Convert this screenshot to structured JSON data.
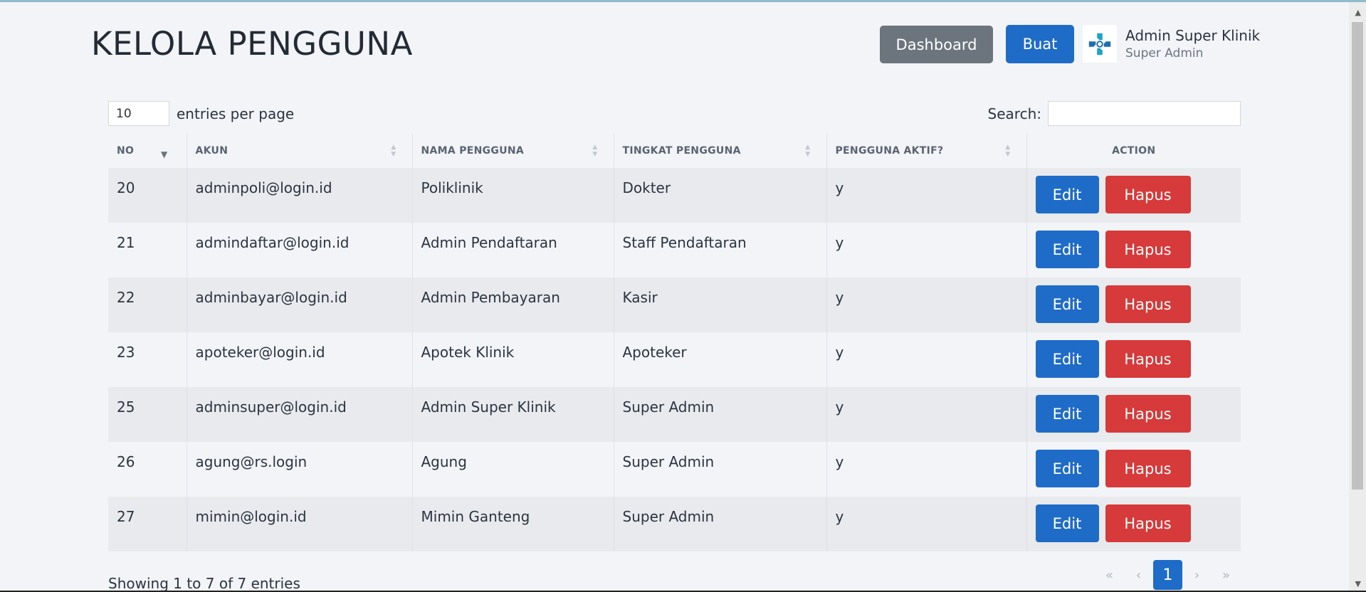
{
  "header": {
    "title": "KELOLA PENGGUNA",
    "dashboard_label": "Dashboard",
    "buat_label": "Buat",
    "user_name": "Admin Super Klinik",
    "user_role": "Super Admin",
    "logo_icon": "clinic-cross-logo-icon"
  },
  "controls": {
    "entries_value": "10",
    "entries_label": "entries per page",
    "search_label": "Search:",
    "search_value": ""
  },
  "table": {
    "columns": [
      "NO",
      "AKUN",
      "NAMA PENGGUNA",
      "TINGKAT PENGGUNA",
      "PENGGUNA AKTIF?",
      "ACTION"
    ],
    "edit_label": "Edit",
    "hapus_label": "Hapus",
    "rows": [
      {
        "no": "20",
        "akun": "adminpoli@login.id",
        "nama": "Poliklinik",
        "tingkat": "Dokter",
        "aktif": "y"
      },
      {
        "no": "21",
        "akun": "admindaftar@login.id",
        "nama": "Admin Pendaftaran",
        "tingkat": "Staff Pendaftaran",
        "aktif": "y"
      },
      {
        "no": "22",
        "akun": "adminbayar@login.id",
        "nama": "Admin Pembayaran",
        "tingkat": "Kasir",
        "aktif": "y"
      },
      {
        "no": "23",
        "akun": "apoteker@login.id",
        "nama": "Apotek Klinik",
        "tingkat": "Apoteker",
        "aktif": "y"
      },
      {
        "no": "25",
        "akun": "adminsuper@login.id",
        "nama": "Admin Super Klinik",
        "tingkat": "Super Admin",
        "aktif": "y"
      },
      {
        "no": "26",
        "akun": "agung@rs.login",
        "nama": "Agung",
        "tingkat": "Super Admin",
        "aktif": "y"
      },
      {
        "no": "27",
        "akun": "mimin@login.id",
        "nama": "Mimin Ganteng",
        "tingkat": "Super Admin",
        "aktif": "y"
      }
    ]
  },
  "footer": {
    "showing": "Showing 1 to 7 of 7 entries",
    "pagination": {
      "first": "«",
      "prev": "‹",
      "current": "1",
      "next": "›",
      "last": "»"
    }
  },
  "colors": {
    "primary": "#1f6cc8",
    "danger": "#d63a3a",
    "secondary": "#6c757d",
    "background": "#f2f4f8"
  }
}
